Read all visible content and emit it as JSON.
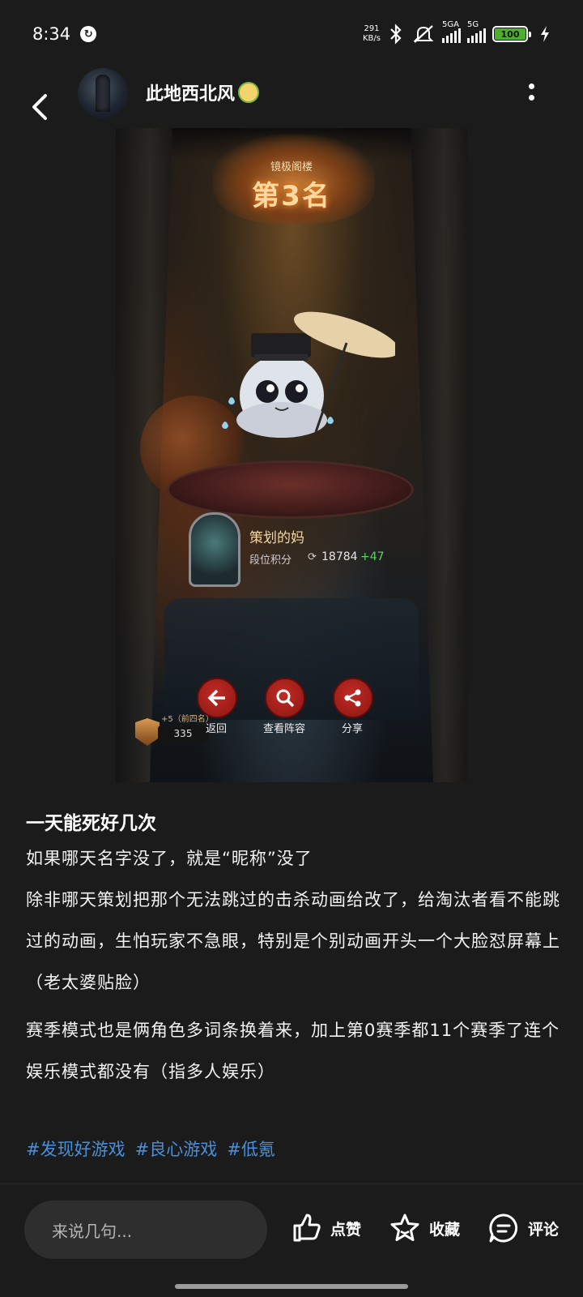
{
  "status_bar": {
    "time": "8:34",
    "net_speed_value": "291",
    "net_speed_unit": "KB/s",
    "signal1_label": "5GA",
    "signal2_label": "5G",
    "battery": "100"
  },
  "header": {
    "username": "此地西北风"
  },
  "game_screenshot": {
    "rank_subtitle": "镜极阁楼",
    "rank_title": "第3名",
    "player_name": "策划的妈",
    "score_label": "段位积分",
    "score_value": "18784",
    "score_delta": "+47",
    "bonus_text": "+5（前四名）",
    "badge_score": "335",
    "buttons": [
      {
        "label": "返回"
      },
      {
        "label": "查看阵容"
      },
      {
        "label": "分享"
      }
    ]
  },
  "post": {
    "title": "一天能死好几次",
    "paragraphs": [
      "如果哪天名字没了，就是“昵称”没了",
      "除非哪天策划把那个无法跳过的击杀动画给改了，给淘汰者看不能跳过的动画，生怕玩家不急眼，特别是个别动画开头一个大脸怼屏幕上（老太婆贴脸）",
      "赛季模式也是俩角色多词条换着来，加上第0赛季都11个赛季了连个娱乐模式都没有（指多人娱乐）"
    ],
    "hashtags": [
      "#发现好游戏",
      "#良心游戏",
      "#低氪"
    ]
  },
  "bottom_bar": {
    "comment_placeholder": "来说几句...",
    "like_label": "点赞",
    "favorite_label": "收藏",
    "comment_label": "评论"
  }
}
